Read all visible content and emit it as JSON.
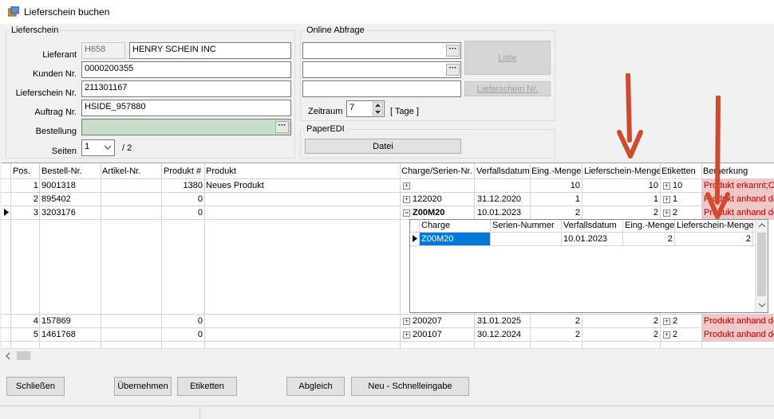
{
  "window": {
    "title": "Lieferschein buchen"
  },
  "lieferschein": {
    "group_label": "Lieferschein",
    "lieferant_label": "Lieferant",
    "lieferant_code": "H658",
    "lieferant_name": "HENRY SCHEIN INC",
    "kunden_label": "Kunden Nr.",
    "kunden_value": "0000200355",
    "ls_label": "Lieferschein Nr.",
    "ls_value": "211301167",
    "auftrag_label": "Auftrag Nr.",
    "auftrag_value": "HSIDE_957880",
    "bestellung_label": "Bestellung",
    "bestellung_value": "",
    "seiten_label": "Seiten",
    "seiten_value": "1",
    "seiten_total": "/ 2"
  },
  "online": {
    "group_label": "Online Abfrage",
    "liste_label": "Liste",
    "lieferschein_btn": "Lieferschein Nr.",
    "zeitraum_label": "Zeitraum",
    "zeitraum_value": "7",
    "tage_label": "[ Tage ]"
  },
  "paperedi": {
    "group_label": "PaperEDI",
    "datei_label": "Datei"
  },
  "grid": {
    "columns": [
      "Pos.",
      "Bestell-Nr.",
      "Artikel-Nr.",
      "Produkt #",
      "Produkt",
      "Charge/Serien-Nr.",
      "Verfallsdatum",
      "Eing.-Menge",
      "Lieferschein-Menge",
      "Etiketten",
      "Bemerkung"
    ],
    "rows": [
      {
        "pos": "1",
        "bestell": "9001318",
        "artikel": "",
        "produkt_nr": "1380",
        "produkt": "Neues Produkt",
        "charge": "",
        "verfall": "",
        "eing": "10",
        "ls_menge": "10",
        "etiketten": "10",
        "bemerkung": "Produkt erkannt;Ch"
      },
      {
        "pos": "2",
        "bestell": "895402",
        "artikel": "",
        "produkt_nr": "0",
        "produkt": "",
        "charge": "122020",
        "verfall": "31.12.2020",
        "eing": "1",
        "ls_menge": "1",
        "etiketten": "1",
        "bemerkung": "Produkt anhand de"
      },
      {
        "pos": "3",
        "bestell": "3203176",
        "artikel": "",
        "produkt_nr": "0",
        "produkt": "",
        "charge": "Z00M20",
        "verfall": "10.01.2023",
        "eing": "2",
        "ls_menge": "2",
        "etiketten": "2",
        "bemerkung": "Produkt anhand de"
      },
      {
        "pos": "4",
        "bestell": "157869",
        "artikel": "",
        "produkt_nr": "0",
        "produkt": "",
        "charge": "200207",
        "verfall": "31.01.2025",
        "eing": "2",
        "ls_menge": "2",
        "etiketten": "2",
        "bemerkung": "Produkt anhand de"
      },
      {
        "pos": "5",
        "bestell": "1461768",
        "artikel": "",
        "produkt_nr": "0",
        "produkt": "",
        "charge": "200107",
        "verfall": "30.12.2024",
        "eing": "2",
        "ls_menge": "2",
        "etiketten": "2",
        "bemerkung": "Produkt anhand de"
      }
    ],
    "subgrid": {
      "columns": [
        "Charge",
        "Serien-Nummer",
        "Verfallsdatum",
        "Eing.-Menge",
        "Lieferschein-Menge"
      ],
      "row": {
        "charge": "Z00M20",
        "serien": "",
        "verfall": "10.01.2023",
        "eing": "2",
        "ls_menge": "2"
      }
    }
  },
  "buttons": {
    "schliessen": "Schließen",
    "uebernehmen": "Übernehmen",
    "etiketten": "Etiketten",
    "abgleich": "Abgleich",
    "neu": "Neu - Schnelleingabe"
  },
  "colors": {
    "accent": "#0078d7",
    "annotation_arrow": "#d04a2f",
    "warning_bg": "#f3c5c5"
  }
}
